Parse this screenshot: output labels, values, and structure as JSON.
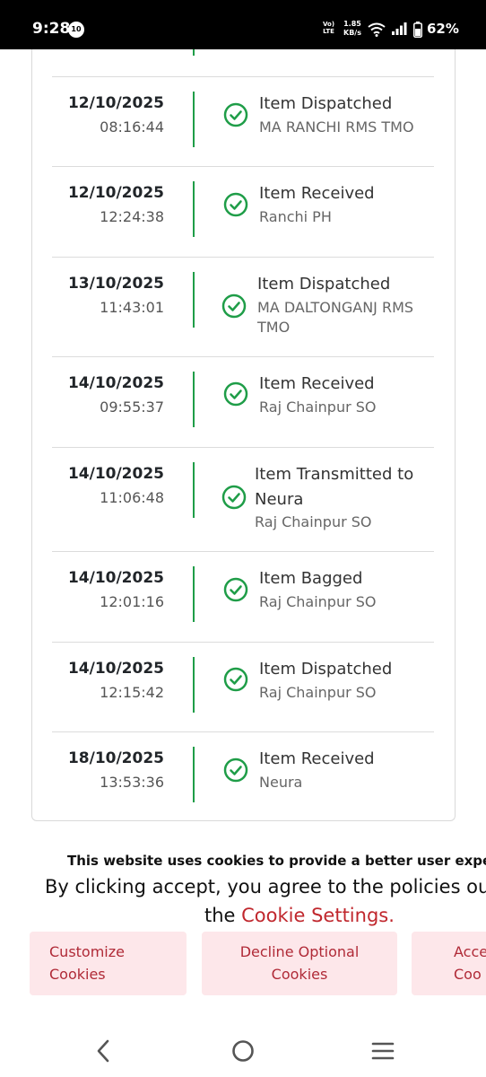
{
  "status_bar": {
    "time": "9:28",
    "notification_badge": "10",
    "volte": "VoLTE",
    "net_speed_value": "1.85",
    "net_speed_unit": "KB/s",
    "battery_percent": "62%"
  },
  "tracking": {
    "accent_color": "#1f9d48",
    "events": [
      {
        "date": "12/10/2025",
        "time": "08:16:44",
        "status": "Item Dispatched",
        "location": "MA RANCHI RMS TMO"
      },
      {
        "date": "12/10/2025",
        "time": "12:24:38",
        "status": "Item Received",
        "location": "Ranchi PH"
      },
      {
        "date": "13/10/2025",
        "time": "11:43:01",
        "status": "Item Dispatched",
        "location_l1": "MA DALTONGANJ RMS",
        "location_l2": "TMO"
      },
      {
        "date": "14/10/2025",
        "time": "09:55:37",
        "status": "Item Received",
        "location": "Raj Chainpur SO"
      },
      {
        "date": "14/10/2025",
        "time": "11:06:48",
        "status_l1": "Item Transmitted to",
        "status_l2": "Neura",
        "location": "Raj Chainpur SO"
      },
      {
        "date": "14/10/2025",
        "time": "12:01:16",
        "status": "Item Bagged",
        "location": "Raj Chainpur SO"
      },
      {
        "date": "14/10/2025",
        "time": "12:15:42",
        "status": "Item Dispatched",
        "location": "Raj Chainpur SO"
      },
      {
        "date": "18/10/2025",
        "time": "13:53:36",
        "status": "Item Received",
        "location": "Neura"
      }
    ]
  },
  "cookie_banner": {
    "title": "This website uses cookies to provide a better user experi",
    "line2": "By clicking accept, you agree to the policies outl",
    "line3_prefix": "the ",
    "link": "Cookie Settings.",
    "customize_l1": "Customize",
    "customize_l2": "Cookies",
    "decline_l1": "Decline Optional",
    "decline_l2": "Cookies",
    "accept_l1": "Acce",
    "accept_l2": "Coo"
  },
  "nav_bar": {
    "icons": [
      "back-icon",
      "home-icon",
      "recents-icon"
    ]
  }
}
